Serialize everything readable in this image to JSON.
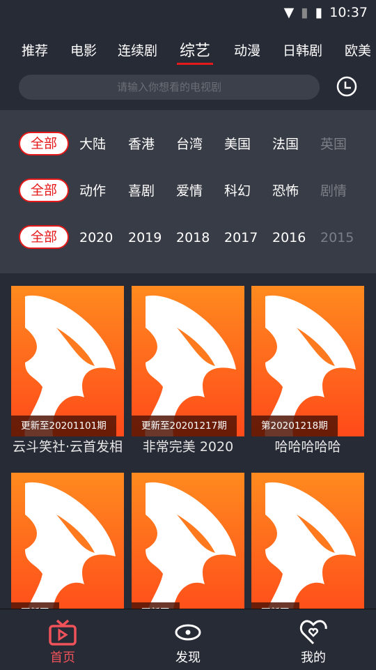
{
  "status": {
    "time": "10:37"
  },
  "tabs": [
    {
      "label": "推荐"
    },
    {
      "label": "电影"
    },
    {
      "label": "连续剧"
    },
    {
      "label": "综艺",
      "active": true
    },
    {
      "label": "动漫"
    },
    {
      "label": "日韩剧"
    },
    {
      "label": "欧美"
    }
  ],
  "search": {
    "placeholder": "请输入你想看的电视剧"
  },
  "filters": {
    "region": [
      "全部",
      "大陆",
      "香港",
      "台湾",
      "美国",
      "法国",
      "英国"
    ],
    "genre": [
      "全部",
      "动作",
      "喜剧",
      "爱情",
      "科幻",
      "恐怖",
      "剧情"
    ],
    "year": [
      "全部",
      "2020",
      "2019",
      "2018",
      "2017",
      "2016",
      "2015"
    ]
  },
  "cards": [
    {
      "badge": "更新至20201101期",
      "title": "云斗笑社·云首发相"
    },
    {
      "badge": "更新至20201217期",
      "title": "非常完美 2020"
    },
    {
      "badge": "第20201218期",
      "title": "哈哈哈哈哈"
    },
    {
      "badge": "更新至",
      "title": ""
    },
    {
      "badge": "更新至",
      "title": ""
    },
    {
      "badge": "更新至",
      "title": ""
    }
  ],
  "nav": [
    {
      "label": "首页",
      "icon": "tv-icon",
      "active": true
    },
    {
      "label": "发现",
      "icon": "eye-icon"
    },
    {
      "label": "我的",
      "icon": "heart-icon"
    }
  ],
  "colors": {
    "accent": "#e51919",
    "nav_active": "#f0525a",
    "poster_top": "#ff8a1f",
    "poster_bottom": "#ff4a1a"
  }
}
